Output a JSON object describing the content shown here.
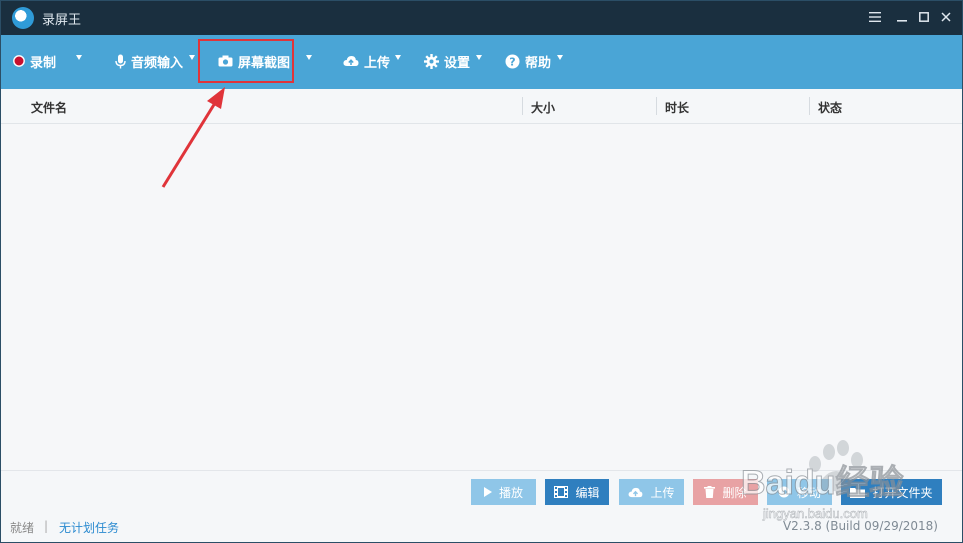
{
  "window": {
    "title": "录屏王"
  },
  "toolbar": {
    "items": [
      {
        "label": "录制",
        "icon": "record-icon"
      },
      {
        "label": "音频输入",
        "icon": "microphone-icon"
      },
      {
        "label": "屏幕截图",
        "icon": "camera-icon"
      },
      {
        "label": "上传",
        "icon": "cloud-upload-icon"
      },
      {
        "label": "设置",
        "icon": "gear-icon"
      },
      {
        "label": "帮助",
        "icon": "help-icon"
      }
    ]
  },
  "table": {
    "columns": [
      "文件名",
      "大小",
      "时长",
      "状态"
    ],
    "rows": []
  },
  "actions": {
    "play": "播放",
    "edit": "编辑",
    "upload": "上传",
    "delete": "删除",
    "move": "移动",
    "open_folder": "打开文件夹"
  },
  "status": {
    "left": "就绪",
    "sep": "|",
    "task_link": "无计划任务",
    "version": "V2.3.8 (Build 09/29/2018)"
  },
  "watermark": {
    "brand": "Baidu经验",
    "domain": "jingyan.baidu.com"
  },
  "colors": {
    "toolbar": "#4aa5d6",
    "titlebar": "#1a2f3f",
    "highlight": "#e0343a",
    "edit_button": "#2f7fbf",
    "delete_button": "#e8a2a4"
  }
}
